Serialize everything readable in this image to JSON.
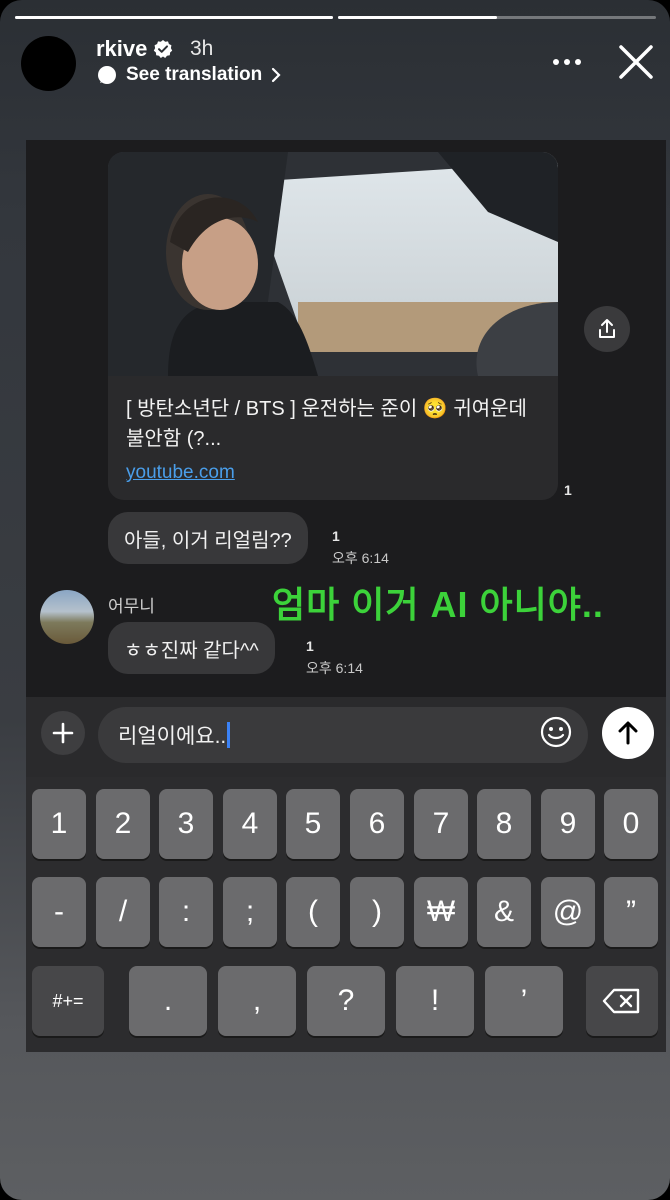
{
  "story": {
    "username": "rkive",
    "time_ago": "3h",
    "translation_label": "See translation",
    "progress": [
      1.0,
      0.5
    ]
  },
  "chat": {
    "link_card": {
      "title": "[ 방탄소년단 / BTS ] 운전하는 준이 🥺 귀여운데 불안함 (?...",
      "domain": "youtube.com",
      "read_count": "1"
    },
    "messages": [
      {
        "sender": "me",
        "text": "아들, 이거 리얼림??",
        "read_count": "1",
        "time": "오후 6:14"
      },
      {
        "sender": "어무니",
        "text": "ㅎㅎ진짜 같다^^",
        "read_count": "1",
        "time": "오후 6:14"
      }
    ],
    "overlay_caption": "엄마 이거 AI 아니야.."
  },
  "composer": {
    "value": "리얼이에요.."
  },
  "keyboard": {
    "row1": [
      "1",
      "2",
      "3",
      "4",
      "5",
      "6",
      "7",
      "8",
      "9",
      "0"
    ],
    "row2": [
      "-",
      "/",
      ":",
      ";",
      "(",
      ")",
      "₩",
      "&",
      "@",
      "”"
    ],
    "row3": [
      "#+=",
      ".",
      ",",
      "?",
      "!",
      "’"
    ]
  },
  "colors": {
    "overlay_green": "#3cd23a",
    "link_blue": "#4a9eea",
    "caret_blue": "#3b82f6"
  }
}
